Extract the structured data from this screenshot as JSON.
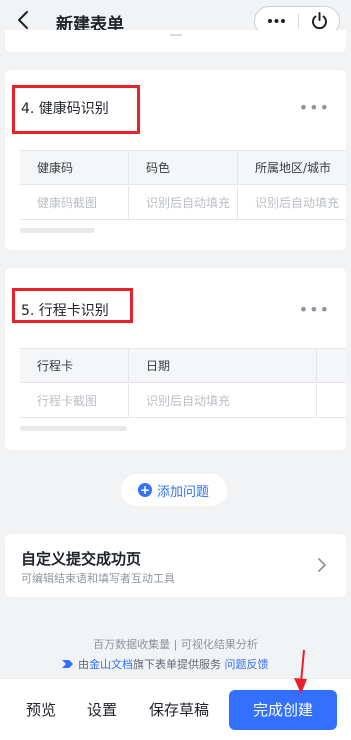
{
  "header": {
    "title": "新建表单",
    "more_glyph": "•••"
  },
  "questions": [
    {
      "title": "4.  健康码识别",
      "more": "•••",
      "columns": [
        "健康码",
        "码色",
        "所属地区/城市"
      ],
      "cells": [
        "健康码截图",
        "识别后自动填充",
        "识别后自动填充"
      ]
    },
    {
      "title": "5.  行程卡识别",
      "more": "•••",
      "columns": [
        "行程卡",
        "日期"
      ],
      "cells": [
        "行程卡截图",
        "识别后自动填充"
      ]
    }
  ],
  "add_question": {
    "plus": "+",
    "label": "添加问题"
  },
  "success_page": {
    "title": "自定义提交成功页",
    "subtitle": "可编辑结束语和填写者互动工具"
  },
  "footer": {
    "line1": "百万数据收集量 | 可视化结果分析",
    "prefix": "由",
    "brand": "金山文档",
    "middle": "旗下表单提供服务",
    "feedback": "问题反馈"
  },
  "bottom_bar": {
    "preview": "预览",
    "settings": "设置",
    "save_draft": "保存草稿",
    "finish": "完成创建"
  },
  "colors": {
    "accent": "#3370ff",
    "highlight": "#e8222c"
  }
}
